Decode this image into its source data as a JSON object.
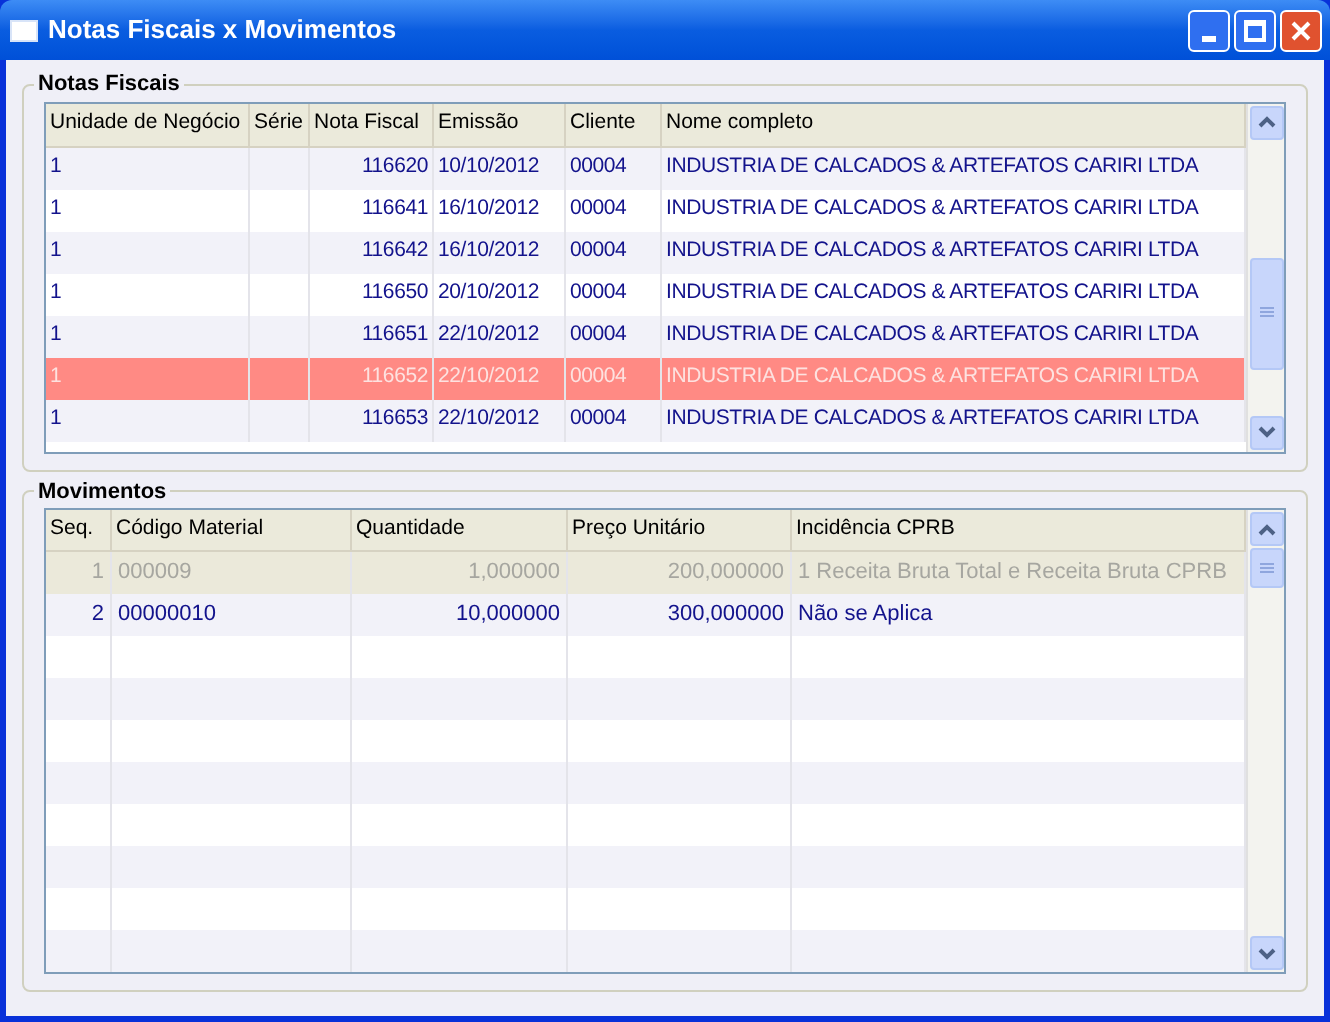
{
  "window": {
    "title": "Notas Fiscais x Movimentos"
  },
  "notas_fiscais": {
    "title": "Notas Fiscais",
    "columns": [
      "Unidade de Negócio",
      "Série",
      "Nota Fiscal",
      "Emissão",
      "Cliente",
      "Nome completo"
    ],
    "rows": [
      {
        "cells": [
          "1",
          "",
          "116620",
          "10/10/2012",
          "00004",
          "INDUSTRIA DE CALCADOS & ARTEFATOS CARIRI LTDA"
        ],
        "selected": false
      },
      {
        "cells": [
          "1",
          "",
          "116641",
          "16/10/2012",
          "00004",
          "INDUSTRIA DE CALCADOS & ARTEFATOS CARIRI LTDA"
        ],
        "selected": false
      },
      {
        "cells": [
          "1",
          "",
          "116642",
          "16/10/2012",
          "00004",
          "INDUSTRIA DE CALCADOS & ARTEFATOS CARIRI LTDA"
        ],
        "selected": false
      },
      {
        "cells": [
          "1",
          "",
          "116650",
          "20/10/2012",
          "00004",
          "INDUSTRIA DE CALCADOS & ARTEFATOS CARIRI LTDA"
        ],
        "selected": false
      },
      {
        "cells": [
          "1",
          "",
          "116651",
          "22/10/2012",
          "00004",
          "INDUSTRIA DE CALCADOS & ARTEFATOS CARIRI LTDA"
        ],
        "selected": false
      },
      {
        "cells": [
          "1",
          "",
          "116652",
          "22/10/2012",
          "00004",
          "INDUSTRIA DE CALCADOS & ARTEFATOS CARIRI LTDA"
        ],
        "selected": true
      },
      {
        "cells": [
          "1",
          "",
          "116653",
          "22/10/2012",
          "00004",
          "INDUSTRIA DE CALCADOS & ARTEFATOS CARIRI LTDA"
        ],
        "selected": false
      }
    ]
  },
  "movimentos": {
    "title": "Movimentos",
    "columns": [
      "Seq.",
      "Código Material",
      "Quantidade",
      "Preço Unitário",
      "Incidência CPRB"
    ],
    "rows": [
      {
        "cells": [
          "1",
          "000009",
          "1,000000",
          "200,000000",
          "1 Receita Bruta Total e Receita Bruta CPRB"
        ],
        "disabled": true
      },
      {
        "cells": [
          "2",
          "00000010",
          "10,000000",
          "300,000000",
          "Não se Aplica"
        ],
        "disabled": false
      }
    ]
  }
}
